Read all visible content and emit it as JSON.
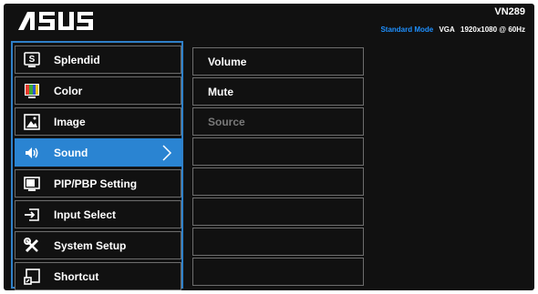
{
  "header": {
    "brand": "ASUS",
    "model": "VN289",
    "mode": "Standard Mode",
    "input": "VGA",
    "resolution": "1920x1080 @ 60Hz"
  },
  "main_menu": [
    {
      "label": "Splendid",
      "icon": "splendid-icon"
    },
    {
      "label": "Color",
      "icon": "color-icon"
    },
    {
      "label": "Image",
      "icon": "image-icon"
    },
    {
      "label": "Sound",
      "icon": "speaker-icon",
      "selected": true
    },
    {
      "label": "PIP/PBP Setting",
      "icon": "pip-icon"
    },
    {
      "label": "Input Select",
      "icon": "input-select-icon"
    },
    {
      "label": "System Setup",
      "icon": "tools-icon"
    },
    {
      "label": "Shortcut",
      "icon": "shortcut-icon"
    }
  ],
  "sub_menu": [
    {
      "label": "Volume",
      "enabled": true
    },
    {
      "label": "Mute",
      "enabled": true
    },
    {
      "label": "Source",
      "enabled": false
    },
    {
      "label": ""
    },
    {
      "label": ""
    },
    {
      "label": ""
    },
    {
      "label": ""
    },
    {
      "label": ""
    }
  ],
  "colors": {
    "accent": "#2a84d2",
    "mode_text": "#1e90ff",
    "background": "#111111",
    "disabled_text": "#7a7a7a"
  }
}
